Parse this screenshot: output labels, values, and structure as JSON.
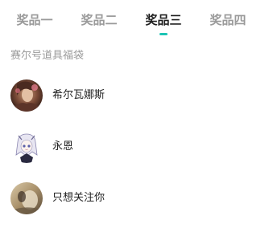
{
  "tabs": [
    {
      "label": "奖品一",
      "active": false
    },
    {
      "label": "奖品二",
      "active": false
    },
    {
      "label": "奖品三",
      "active": true
    },
    {
      "label": "奖品四",
      "active": false
    }
  ],
  "colors": {
    "accent": "#1cc4b4",
    "active_text": "#1f1f1f",
    "inactive_text": "#9a9a9a",
    "section_text": "#9a9a9a",
    "name_text": "#222222"
  },
  "section": {
    "title": "赛尔号道具福袋"
  },
  "winners": [
    {
      "name": "希尔瓦娜斯",
      "avatar": "user-avatar"
    },
    {
      "name": "永恩",
      "avatar": "user-avatar"
    },
    {
      "name": "只想关注你",
      "avatar": "user-avatar"
    }
  ]
}
